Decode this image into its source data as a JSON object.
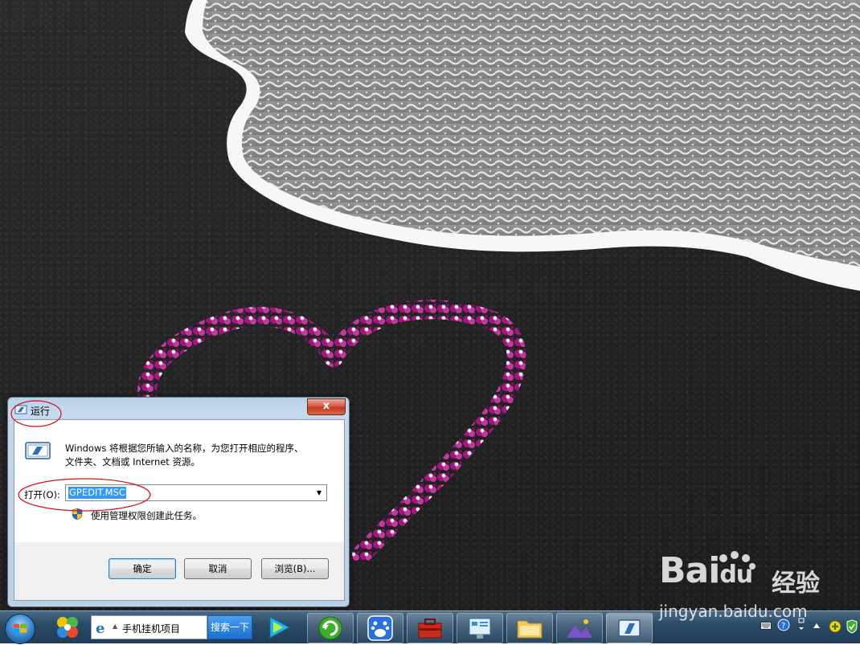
{
  "run_dialog": {
    "title": "运行",
    "description_line1": "Windows 将根据您所输入的名称，为您打开相应的程序、",
    "description_line2": "文件夹、文档或 Internet 资源。",
    "open_label": "打开(O):",
    "command_value": "GPEDIT.MSC",
    "admin_note": "使用管理权限创建此任务。",
    "ok_label": "确定",
    "cancel_label": "取消",
    "browse_label": "浏览(B)...",
    "close_glyph": "x"
  },
  "taskbar": {
    "search_text": "手机挂机项目",
    "search_button": "搜索一下",
    "ie_glyph": "e",
    "apps": [
      "360-security-icon",
      "media-player-icon",
      "browser-icon",
      "baidu-app-icon",
      "toolbox-icon",
      "control-panel-icon",
      "explorer-folder-icon",
      "photos-icon",
      "run-window-icon"
    ]
  },
  "watermark": {
    "brand_text": "Bai",
    "brand_du": "du",
    "brand_cn": "经验",
    "url": "jingyan.baidu.com"
  },
  "colors": {
    "annotation_red": "#d8111b",
    "selection_blue": "#3399ff",
    "taskbar": "#1f3d59"
  }
}
